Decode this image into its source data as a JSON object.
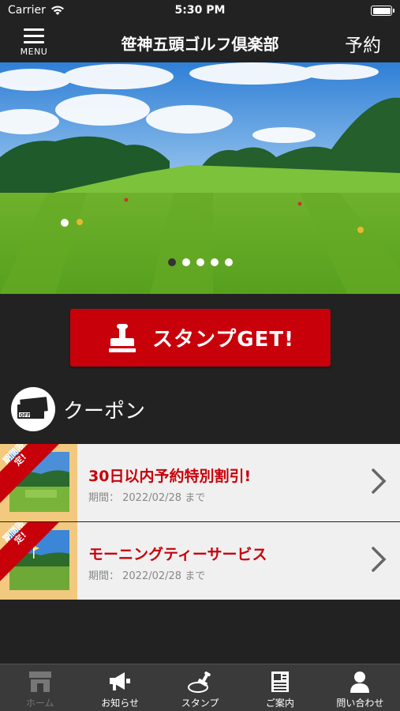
{
  "status_bar": {
    "carrier": "Carrier",
    "time": "5:30 PM"
  },
  "navbar": {
    "menu_label": "MENU",
    "title": "笹神五頭ゴルフ倶楽部",
    "reserve_label": "予約"
  },
  "hero": {
    "slide_count": 5,
    "active_slide": 1
  },
  "stamp_button": {
    "label": "スタンプGET!"
  },
  "coupon_section": {
    "title": "クーポン"
  },
  "coupons": [
    {
      "badge": "期間限定!",
      "title": "30日以内予約特別割引!",
      "period": "期間： 2022/02/28 まで"
    },
    {
      "badge": "期間限定!",
      "title": "モーニングティーサービス",
      "period": "期間： 2022/02/28 まで"
    }
  ],
  "tabbar": {
    "items": [
      {
        "label": "ホーム",
        "icon": "home-icon",
        "active": false
      },
      {
        "label": "お知らせ",
        "icon": "megaphone-icon",
        "active": true
      },
      {
        "label": "スタンプ",
        "icon": "stamp-icon",
        "active": true
      },
      {
        "label": "ご案内",
        "icon": "document-icon",
        "active": true
      },
      {
        "label": "問い合わせ",
        "icon": "person-icon",
        "active": true
      }
    ]
  },
  "colors": {
    "accent_red": "#c8000a",
    "background": "#222222",
    "coupon_badge_bg": "#f2c97f"
  }
}
